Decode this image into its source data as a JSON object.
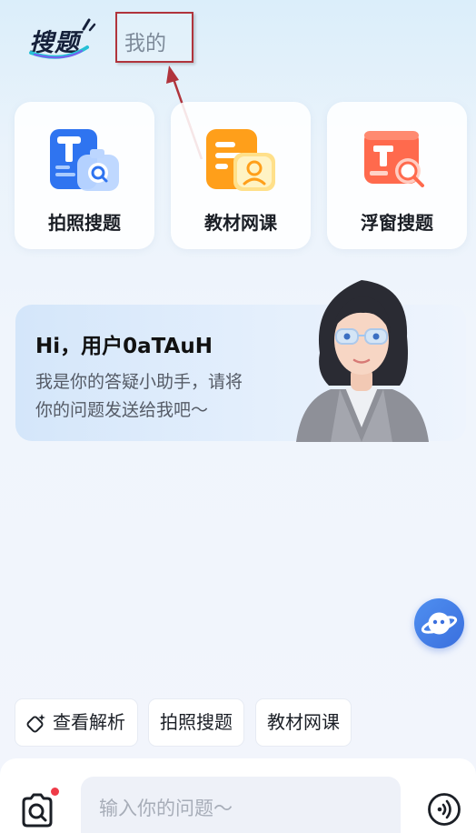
{
  "header": {
    "logo_text": "搜题",
    "tab_mine_label": "我的"
  },
  "features": [
    {
      "label": "拍照搜题",
      "icon": "photo-search-icon"
    },
    {
      "label": "教材网课",
      "icon": "textbook-course-icon"
    },
    {
      "label": "浮窗搜题",
      "icon": "floating-window-search-icon"
    }
  ],
  "banner": {
    "title": "Hi，用户0aTAuH",
    "line1": "我是你的答疑小助手，请将",
    "line2": "你的问题发送给我吧～"
  },
  "chips": [
    {
      "label": "查看解析",
      "icon": "sparkle-edit-icon"
    },
    {
      "label": "拍照搜题"
    },
    {
      "label": "教材网课"
    }
  ],
  "input": {
    "placeholder": "输入你的问题～"
  },
  "colors": {
    "accent_blue": "#3a6fde",
    "highlight_box": "#b0343c",
    "notification_dot": "#ef3b48"
  }
}
